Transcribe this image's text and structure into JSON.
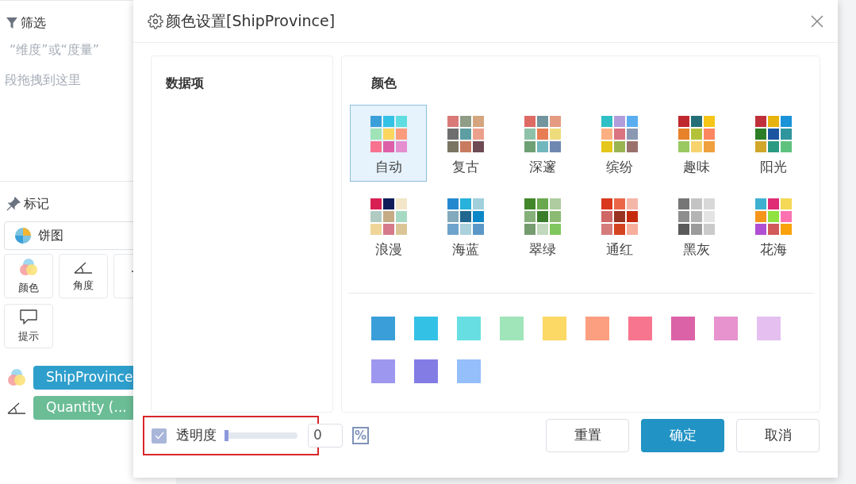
{
  "sidebar": {
    "filter_title": "筛选",
    "filter_hint_1": "“维度”或“度量”",
    "filter_hint_2": "段拖拽到这里",
    "marks_title": "标记",
    "chart_type": "饼图",
    "mark_buttons": [
      {
        "kind": "color",
        "label": "颜色"
      },
      {
        "kind": "angle",
        "label": "角度"
      },
      {
        "kind": "label"
      },
      {
        "kind": "tooltip",
        "label": "提示"
      }
    ],
    "fields": [
      {
        "kind": "color",
        "label": "ShipProvince",
        "color": "#2e9fcc"
      },
      {
        "kind": "angle",
        "label": "Quantity (...",
        "color": "#6bbd96"
      }
    ]
  },
  "dialog": {
    "title": "颜色设置[ShipProvince]",
    "data_items_title": "数据项",
    "color_title": "颜色",
    "palettes": [
      {
        "label": "自动",
        "selected": true,
        "colors": [
          {
            "color": "#3a9fd9"
          },
          {
            "color": "#33c1e6"
          },
          {
            "color": "#5fdde0"
          },
          {
            "color": "#9fe3b7"
          },
          {
            "color": "#fcd65f"
          },
          {
            "color": "#fc9b7c"
          },
          {
            "color": "#f7728f"
          },
          {
            "color": "#dd5fa8"
          },
          {
            "color": "#e58fd0"
          }
        ]
      },
      {
        "label": "复古",
        "selected": false,
        "colors": [
          {
            "color": "#d97a78"
          },
          {
            "color": "#909e88"
          },
          {
            "color": "#d4a57e"
          },
          {
            "color": "#6e6e6e"
          },
          {
            "color": "#5d9ea3"
          },
          {
            "color": "#eba08c"
          },
          {
            "color": "#7a7563"
          },
          {
            "color": "#c97b60"
          },
          {
            "color": "#6e4a55"
          }
        ]
      },
      {
        "label": "深邃",
        "selected": false,
        "colors": [
          {
            "color": "#de6a64"
          },
          {
            "color": "#72959e"
          },
          {
            "color": "#e59b82"
          },
          {
            "color": "#8ec2a8"
          },
          {
            "color": "#e87c52"
          },
          {
            "color": "#eedc7c"
          },
          {
            "color": "#6fa073"
          },
          {
            "color": "#72b6be"
          },
          {
            "color": "#6f88b0"
          }
        ]
      },
      {
        "label": "缤纷",
        "selected": false,
        "colors": [
          {
            "color": "#2ec0c5"
          },
          {
            "color": "#b29ddb"
          },
          {
            "color": "#5aaef0"
          },
          {
            "color": "#fcb082"
          },
          {
            "color": "#d97480"
          },
          {
            "color": "#8a98b2"
          },
          {
            "color": "#e5c61b"
          },
          {
            "color": "#9ab453"
          },
          {
            "color": "#9b716e"
          }
        ]
      },
      {
        "label": "趣味",
        "selected": false,
        "colors": [
          {
            "color": "#c0282f"
          },
          {
            "color": "#246f77"
          },
          {
            "color": "#f5c518"
          },
          {
            "color": "#e7822a"
          },
          {
            "color": "#b4c23a"
          },
          {
            "color": "#fc8660"
          },
          {
            "color": "#9ac862"
          },
          {
            "color": "#f7d36e"
          },
          {
            "color": "#f0a03e"
          }
        ]
      },
      {
        "label": "阳光",
        "selected": false,
        "colors": [
          {
            "color": "#c0303a"
          },
          {
            "color": "#e7b30f"
          },
          {
            "color": "#1a93d8"
          },
          {
            "color": "#2c7d26"
          },
          {
            "color": "#1c56a0"
          },
          {
            "color": "#2f969e"
          },
          {
            "color": "#d1a72a"
          },
          {
            "color": "#2a9b82"
          },
          {
            "color": "#5ec27e"
          }
        ]
      },
      {
        "label": "浪漫",
        "selected": false,
        "colors": [
          {
            "color": "#d81f54"
          },
          {
            "color": "#101c5a"
          },
          {
            "color": "#f3e6c8"
          },
          {
            "color": "#b1cbc3"
          },
          {
            "color": "#c5ab86"
          },
          {
            "color": "#a6d9c3"
          },
          {
            "color": "#efd698"
          },
          {
            "color": "#d57a8a"
          },
          {
            "color": "#dbc596"
          }
        ]
      },
      {
        "label": "海蓝",
        "selected": false,
        "colors": [
          {
            "color": "#2589d0"
          },
          {
            "color": "#28b1db"
          },
          {
            "color": "#9fd0dc"
          },
          {
            "color": "#82a9bc"
          },
          {
            "color": "#20668f"
          },
          {
            "color": "#0c87c7"
          },
          {
            "color": "#6ea3cc"
          },
          {
            "color": "#aad1dc"
          },
          {
            "color": "#5b98c8"
          }
        ]
      },
      {
        "label": "翠绿",
        "selected": false,
        "colors": [
          {
            "color": "#418729"
          },
          {
            "color": "#6aa84f"
          },
          {
            "color": "#aecc9f"
          },
          {
            "color": "#86b07a"
          },
          {
            "color": "#3a7d2b"
          },
          {
            "color": "#8bba72"
          },
          {
            "color": "#759c6e"
          },
          {
            "color": "#c1d8bd"
          },
          {
            "color": "#7fc65f"
          }
        ]
      },
      {
        "label": "通红",
        "selected": false,
        "colors": [
          {
            "color": "#d9381e"
          },
          {
            "color": "#eb6649"
          },
          {
            "color": "#f5b6aa"
          },
          {
            "color": "#d06666"
          },
          {
            "color": "#993322"
          },
          {
            "color": "#c52a0e"
          },
          {
            "color": "#d57b7b"
          },
          {
            "color": "#d4431f"
          },
          {
            "color": "#f7ae9c"
          }
        ]
      },
      {
        "label": "黑灰",
        "selected": false,
        "colors": [
          {
            "color": "#767676"
          },
          {
            "color": "#c4c4c4"
          },
          {
            "color": "#d8d8d8"
          },
          {
            "color": "#8e8e8e"
          },
          {
            "color": "#b4b4b4"
          },
          {
            "color": "#e4e4e4"
          },
          {
            "color": "#5a5a5a"
          },
          {
            "color": "#9b9b9b"
          },
          {
            "color": "#cacaca"
          }
        ]
      },
      {
        "label": "花海",
        "selected": false,
        "colors": [
          {
            "color": "#3eb1d1"
          },
          {
            "color": "#df2c74"
          },
          {
            "color": "#f5d855"
          },
          {
            "color": "#f6951b"
          },
          {
            "color": "#8fe23f"
          },
          {
            "color": "#fb72b1"
          },
          {
            "color": "#b04fd3"
          },
          {
            "color": "#d25a5a"
          },
          {
            "color": "#f9a20b"
          }
        ]
      }
    ],
    "swatches": [
      {
        "color": "#3a9fd9"
      },
      {
        "color": "#33c1e6"
      },
      {
        "color": "#67dfe2"
      },
      {
        "color": "#a0e4b9"
      },
      {
        "color": "#fcd865"
      },
      {
        "color": "#fc9e80"
      },
      {
        "color": "#f7758f"
      },
      {
        "color": "#dc62a8"
      },
      {
        "color": "#e693ce"
      },
      {
        "color": "#e4bff0"
      },
      {
        "color": "#9e97ef"
      },
      {
        "color": "#837ce4"
      },
      {
        "color": "#94bffb"
      }
    ],
    "opacity": {
      "checked": true,
      "label": "透明度",
      "level": 0,
      "value": "0",
      "unit": "%"
    },
    "buttons": [
      {
        "kind": "secondary",
        "label": "重置"
      },
      {
        "kind": "primary",
        "label": "确定"
      },
      {
        "kind": "secondary",
        "label": "取消"
      }
    ]
  }
}
